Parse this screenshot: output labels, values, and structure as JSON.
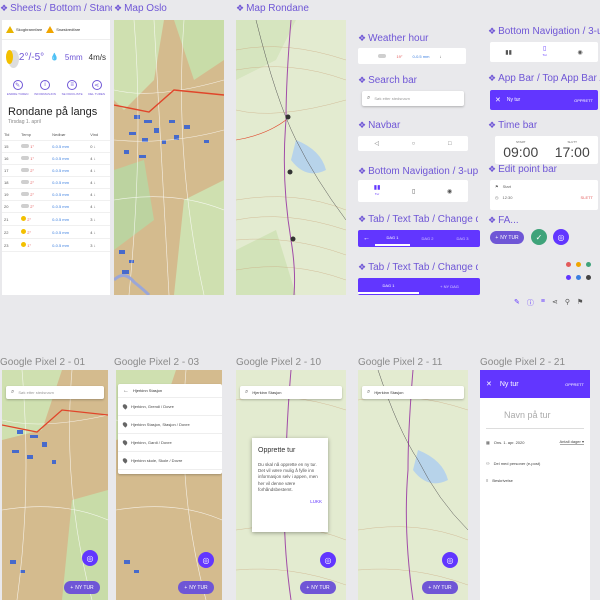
{
  "frames": {
    "sheets": "Sheets / Bottom / Stand...",
    "map_oslo": "Map Oslo",
    "map_rondane": "Map Rondane",
    "weather_hour": "Weather hour",
    "search_bar": "Search bar",
    "navbar": "Navbar",
    "bottom_nav": "Bottom Navigation / 3-up",
    "bottom_nav2": "Bottom Navigation / 3-up",
    "app_bar": "App Bar / Top App Bar / 3...",
    "time_bar": "Time bar",
    "edit_point_bar": "Edit point bar",
    "tab1": "Tab / Text Tab / Change d...",
    "tab2": "Tab / Text Tab / Change d...",
    "fa": "FA...",
    "pixel1": "Google Pixel 2 - 01",
    "pixel2": "Google Pixel 2 - 03",
    "pixel3": "Google Pixel 2 - 10",
    "pixel4": "Google Pixel 2 - 11",
    "pixel5": "Google Pixel 2 - 21"
  },
  "sheet": {
    "warn1": "Skogbrannfare",
    "warn2": "Snøskredfare",
    "temp": "2°/-5°",
    "precip": "5mm",
    "wind": "4m/s",
    "actions": [
      "ENDRE TUREN",
      "INFORMASJON",
      "SE PAKKLISTE",
      "DEL TUREN"
    ],
    "title": "Rondane på langs",
    "date": "Tirsdag 1. april",
    "cols": [
      "Tid",
      "Temp",
      "Nedbør",
      "Vind"
    ],
    "rows": [
      {
        "t": "15",
        "temp": "1°",
        "mm": "0-0.5 mm",
        "w": "0"
      },
      {
        "t": "16",
        "temp": "1°",
        "mm": "0-0.5 mm",
        "w": "4"
      },
      {
        "t": "17",
        "temp": "2°",
        "mm": "0-0.5 mm",
        "w": "4"
      },
      {
        "t": "18",
        "temp": "2°",
        "mm": "0-0.5 mm",
        "w": "4"
      },
      {
        "t": "19",
        "temp": "2°",
        "mm": "0-0.5 mm",
        "w": "4"
      },
      {
        "t": "20",
        "temp": "2°",
        "mm": "0-0.5 mm",
        "w": "4"
      },
      {
        "t": "21",
        "temp": "2°",
        "mm": "0-0.5 mm",
        "w": "3"
      },
      {
        "t": "22",
        "temp": "2°",
        "mm": "0-0.5 mm",
        "w": "4"
      },
      {
        "t": "23",
        "temp": "1°",
        "mm": "0-0.5 mm",
        "w": "3"
      }
    ]
  },
  "weather_bar": {
    "temp": "19°",
    "precip": "0-0.5 mm",
    "hour": "10"
  },
  "search_placeholder": "Søk etter stedsnavn",
  "bottom_nav_tab": "Tur",
  "app_bar_title": "Ny tur",
  "app_bar_action": "OPPRETT",
  "time": {
    "start_label": "START",
    "start": "09:00",
    "end_label": "SLUTT",
    "end": "17:00"
  },
  "edit_point": {
    "start": "Start",
    "time": "12:30",
    "delete": "SLETT"
  },
  "tabs": {
    "tab1": "DAG 1",
    "tab2": "DAG 2",
    "tab3": "DAG 3",
    "next": "NY DAG"
  },
  "new_trip_button": "NY TUR",
  "pixel_search": "Hjerkinn Stasjon",
  "search_results": [
    "Hjerkinn, Grendi / Dovre",
    "Hjerkinn Stasjon, Stasjon / Dovre",
    "Hjerkinn, Gardi / Dovre",
    "Hjerkinn skole, Skole / Dovre"
  ],
  "dialog": {
    "title": "Opprette tur",
    "body": "Du skal nå opprette en ny tur. Det vil være mulig å fylle inn informasjon selv i appen, men her vil denne være forhåndsbestemt.",
    "action": "LUKK"
  },
  "new_trip_form": {
    "title": "Ny tur",
    "name_placeholder": "Navn på tur",
    "date": "Ons. 1. apr. 2020",
    "days": "Antall dager",
    "persons": "Del med personer (e-post)",
    "description": "Beskrivelse",
    "action": "OPPRETT"
  },
  "colors": {
    "accent": "#6236ff",
    "title": "#6f56d6",
    "fab_green": "#3fa37a"
  }
}
